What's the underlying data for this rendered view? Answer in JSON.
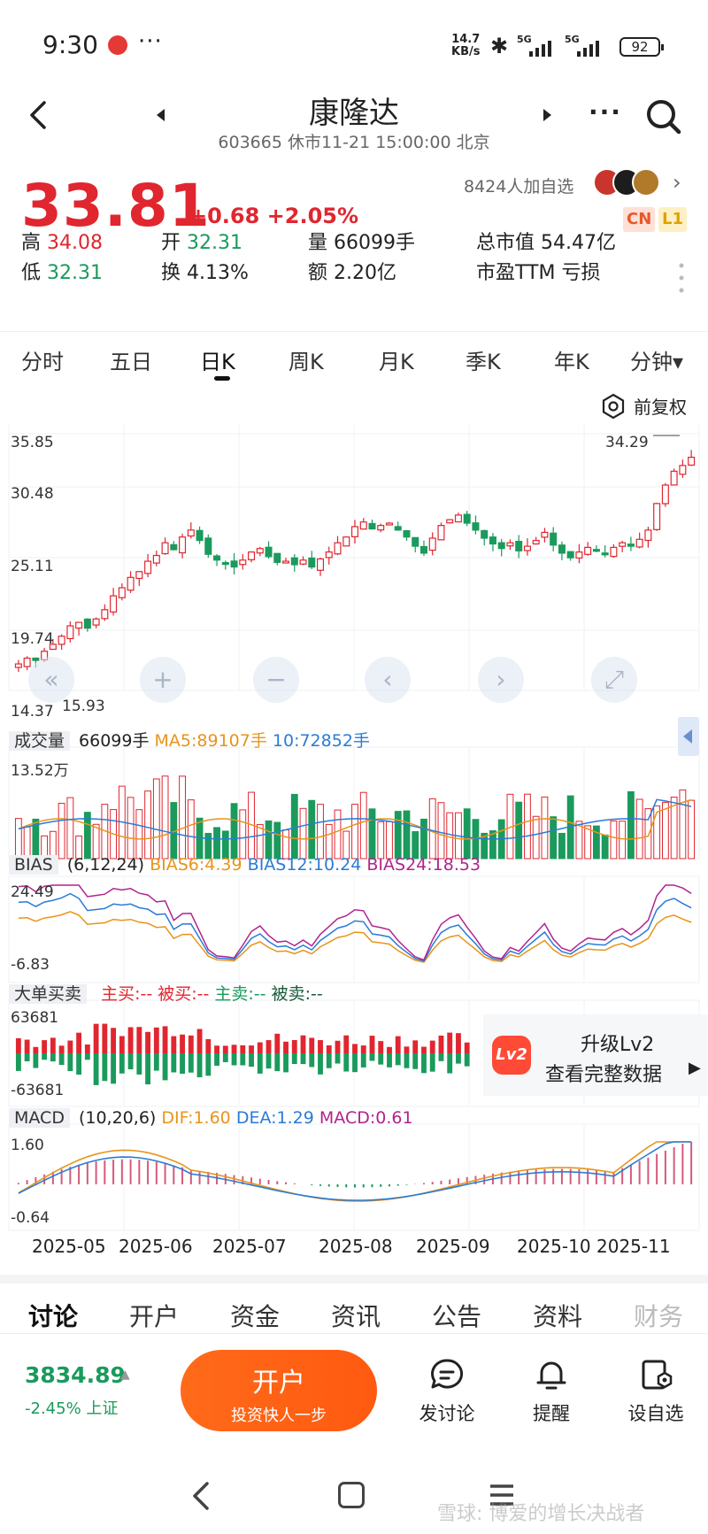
{
  "status_bar": {
    "time": "9:30",
    "app_icon": "app-notification-icon",
    "more": "···",
    "speed_value": "14.7",
    "speed_unit": "KB/s",
    "signal_label": "5G",
    "battery": "92"
  },
  "header": {
    "name": "康隆达",
    "subtitle": "603665 休市11-21 15:00:00 北京"
  },
  "quote": {
    "price": "33.81",
    "change": "+0.68 +2.05%",
    "watchers": "8424人加自选",
    "badge_cn": "CN",
    "badge_l1": "L1",
    "row1": [
      {
        "label": "高",
        "value": "34.08",
        "color": "red"
      },
      {
        "label": "开",
        "value": "32.31",
        "color": "green"
      },
      {
        "label": "量",
        "value": "66099手",
        "color": "plain"
      },
      {
        "label": "总市值",
        "value": "54.47亿",
        "color": "plain"
      }
    ],
    "row2": [
      {
        "label": "低",
        "value": "32.31",
        "color": "green"
      },
      {
        "label": "换",
        "value": "4.13%",
        "color": "plain"
      },
      {
        "label": "额",
        "value": "2.20亿",
        "color": "plain"
      },
      {
        "label": "市盈TTM",
        "value": "亏损",
        "color": "plain"
      }
    ]
  },
  "period_tabs": [
    "分时",
    "五日",
    "日K",
    "周K",
    "月K",
    "季K",
    "年K",
    "分钟▾"
  ],
  "active_period": "日K",
  "adjust_label": "前复权",
  "main_chart": {
    "y_labels": [
      "35.85",
      "30.48",
      "25.11",
      "19.74",
      "14.37"
    ],
    "max_label": "34.29",
    "min_label": "15.93"
  },
  "volume": {
    "tag": "成交量",
    "value": "66099手",
    "ma5": "MA5:89107手",
    "ma10": "10:72852手",
    "ymax": "13.52万"
  },
  "bias": {
    "tag": "BIAS",
    "params": "(6,12,24)",
    "b6": "BIAS6:4.39",
    "b12": "BIAS12:10.24",
    "b24": "BIAS24:18.53",
    "ymax": "24.49",
    "ymin": "-6.83"
  },
  "big_order": {
    "tag": "大单买卖",
    "zhu_mai": "主买:--",
    "bei_mai": "被买:--",
    "zhu_mai2": "主卖:--",
    "bei_mai2": "被卖:--",
    "ymax": "63681",
    "ymin": "-63681",
    "upgrade_t1": "升级Lv2",
    "upgrade_t2": "查看完整数据",
    "upgrade_icon": "Lv2"
  },
  "macd": {
    "tag": "MACD",
    "params": "(10,20,6)",
    "dif": "DIF:1.60",
    "dea": "DEA:1.29",
    "macd": "MACD:0.61",
    "ymax": "1.60",
    "ymin": "-0.64"
  },
  "x_axis": [
    "2025-05",
    "2025-06",
    "2025-07",
    "2025-08",
    "2025-09",
    "2025-10",
    "2025-11"
  ],
  "sub_tabs": [
    "讨论",
    "开户",
    "资金",
    "资讯",
    "公告",
    "资料",
    "财务"
  ],
  "active_sub_tab": "讨论",
  "bottom": {
    "index_value": "3834.89",
    "index_change": "-2.45% 上证",
    "open_title": "开户",
    "open_sub": "投资快人一步",
    "discuss": "发讨论",
    "remind": "提醒",
    "watch": "设自选"
  },
  "watermark": "雪球: 博爱的增长决战者",
  "chart_data": {
    "type": "candlestick",
    "title": "康隆达",
    "ylim": [
      14.37,
      35.85
    ],
    "x_ticks": [
      "2025-05",
      "2025-06",
      "2025-07",
      "2025-08",
      "2025-09",
      "2025-10",
      "2025-11"
    ],
    "close_series": [
      15.9,
      16.4,
      16.2,
      17.0,
      17.6,
      18.3,
      19.2,
      19.5,
      19.0,
      19.8,
      20.6,
      21.8,
      22.5,
      23.4,
      23.9,
      24.8,
      25.3,
      26.4,
      25.8,
      26.9,
      27.5,
      26.6,
      25.4,
      24.9,
      24.6,
      24.3,
      24.9,
      25.6,
      25.9,
      25.2,
      24.7,
      24.8,
      24.5,
      24.9,
      24.3,
      25.0,
      25.6,
      26.4,
      26.9,
      27.8,
      28.2,
      27.6,
      27.9,
      28.1,
      27.5,
      26.9,
      26.1,
      25.5,
      26.8,
      27.9,
      28.4,
      28.8,
      28.1,
      27.5,
      26.8,
      26.3,
      25.9,
      26.4,
      25.7,
      26.1,
      26.6,
      27.3,
      26.2,
      25.5,
      25.1,
      25.6,
      26.0,
      25.8,
      25.5,
      26.0,
      26.4,
      26.1,
      26.7,
      27.5,
      29.8,
      31.4,
      32.6,
      33.1,
      33.81
    ],
    "volume_max": "13.52万",
    "latest_volume": 66099,
    "bias": {
      "BIAS6": 4.39,
      "BIAS12": 10.24,
      "BIAS24": 18.53,
      "ylim": [
        -6.83,
        24.49
      ]
    },
    "macd": {
      "DIF": 1.6,
      "DEA": 1.29,
      "MACD": 0.61,
      "ylim": [
        -0.64,
        1.6
      ]
    },
    "colors": {
      "up": "#e0262f",
      "down": "#1a9a5c",
      "ma5": "#e8941a",
      "ma10": "#2b7bd6",
      "ma24": "#b0248e"
    }
  }
}
